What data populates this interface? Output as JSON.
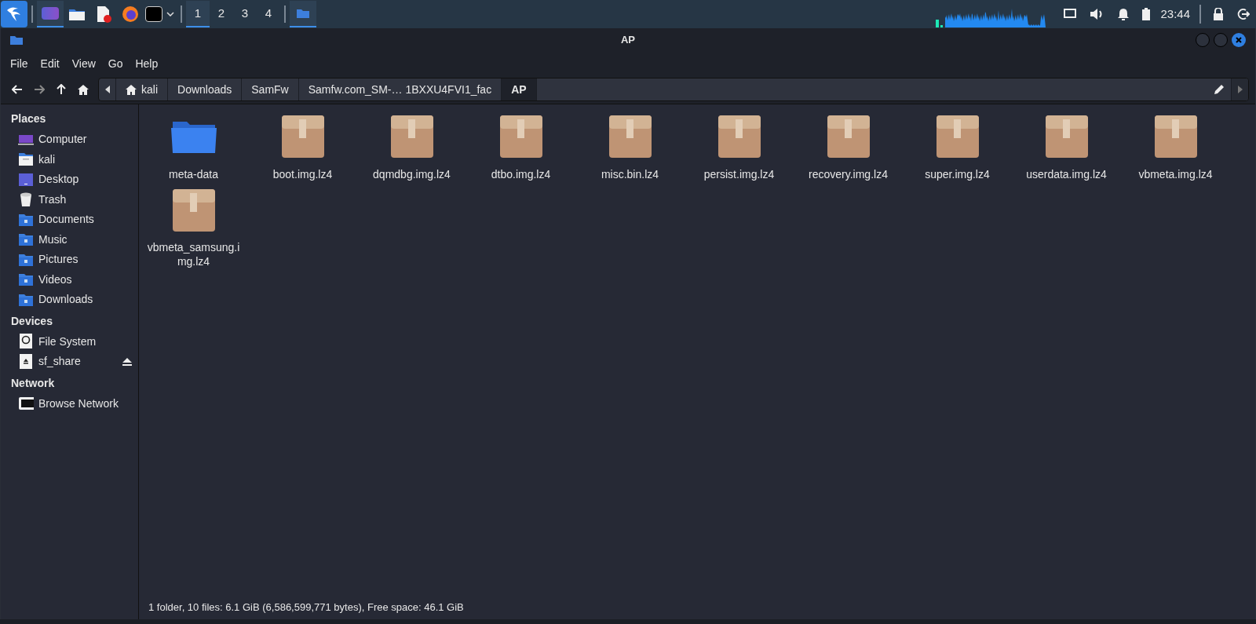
{
  "taskbar": {
    "workspaces": [
      {
        "label": "1",
        "selected": true
      },
      {
        "label": "2",
        "selected": false
      },
      {
        "label": "3",
        "selected": false
      },
      {
        "label": "4",
        "selected": false
      }
    ],
    "clock": "23:44"
  },
  "window": {
    "title": "AP"
  },
  "menu": [
    "File",
    "Edit",
    "View",
    "Go",
    "Help"
  ],
  "breadcrumbs": [
    {
      "label": "kali",
      "kind": "home",
      "selected": false
    },
    {
      "label": "Downloads",
      "kind": "folder",
      "selected": false
    },
    {
      "label": "SamFw",
      "kind": "folder",
      "selected": false
    },
    {
      "label": "Samfw.com_SM-… 1BXXU4FVI1_fac",
      "kind": "folder",
      "selected": false
    },
    {
      "label": "AP",
      "kind": "folder",
      "selected": true
    }
  ],
  "sidebar": [
    {
      "heading": "Places",
      "items": [
        {
          "label": "Computer",
          "kind": "computer"
        },
        {
          "label": "kali",
          "kind": "home"
        },
        {
          "label": "Desktop",
          "kind": "desktop"
        },
        {
          "label": "Trash",
          "kind": "trash"
        },
        {
          "label": "Documents",
          "kind": "folder"
        },
        {
          "label": "Music",
          "kind": "folder"
        },
        {
          "label": "Pictures",
          "kind": "folder"
        },
        {
          "label": "Videos",
          "kind": "folder"
        },
        {
          "label": "Downloads",
          "kind": "folder"
        }
      ]
    },
    {
      "heading": "Devices",
      "items": [
        {
          "label": "File System",
          "kind": "drive"
        },
        {
          "label": "sf_share",
          "kind": "removable"
        }
      ]
    },
    {
      "heading": "Network",
      "items": [
        {
          "label": "Browse Network",
          "kind": "network"
        }
      ]
    }
  ],
  "files": [
    {
      "name": "meta-data",
      "kind": "folder"
    },
    {
      "name": "boot.img.lz4",
      "kind": "archive"
    },
    {
      "name": "dqmdbg.img.lz4",
      "kind": "archive"
    },
    {
      "name": "dtbo.img.lz4",
      "kind": "archive"
    },
    {
      "name": "misc.bin.lz4",
      "kind": "archive"
    },
    {
      "name": "persist.img.lz4",
      "kind": "archive"
    },
    {
      "name": "recovery.img.lz4",
      "kind": "archive"
    },
    {
      "name": "super.img.lz4",
      "kind": "archive"
    },
    {
      "name": "userdata.img.lz4",
      "kind": "archive"
    },
    {
      "name": "vbmeta.img.lz4",
      "kind": "archive"
    },
    {
      "name": "vbmeta_samsung.img.lz4",
      "kind": "archive"
    }
  ],
  "status_bar": "1 folder, 10 files: 6.1 GiB (6,586,599,771 bytes), Free space: 46.1 GiB"
}
